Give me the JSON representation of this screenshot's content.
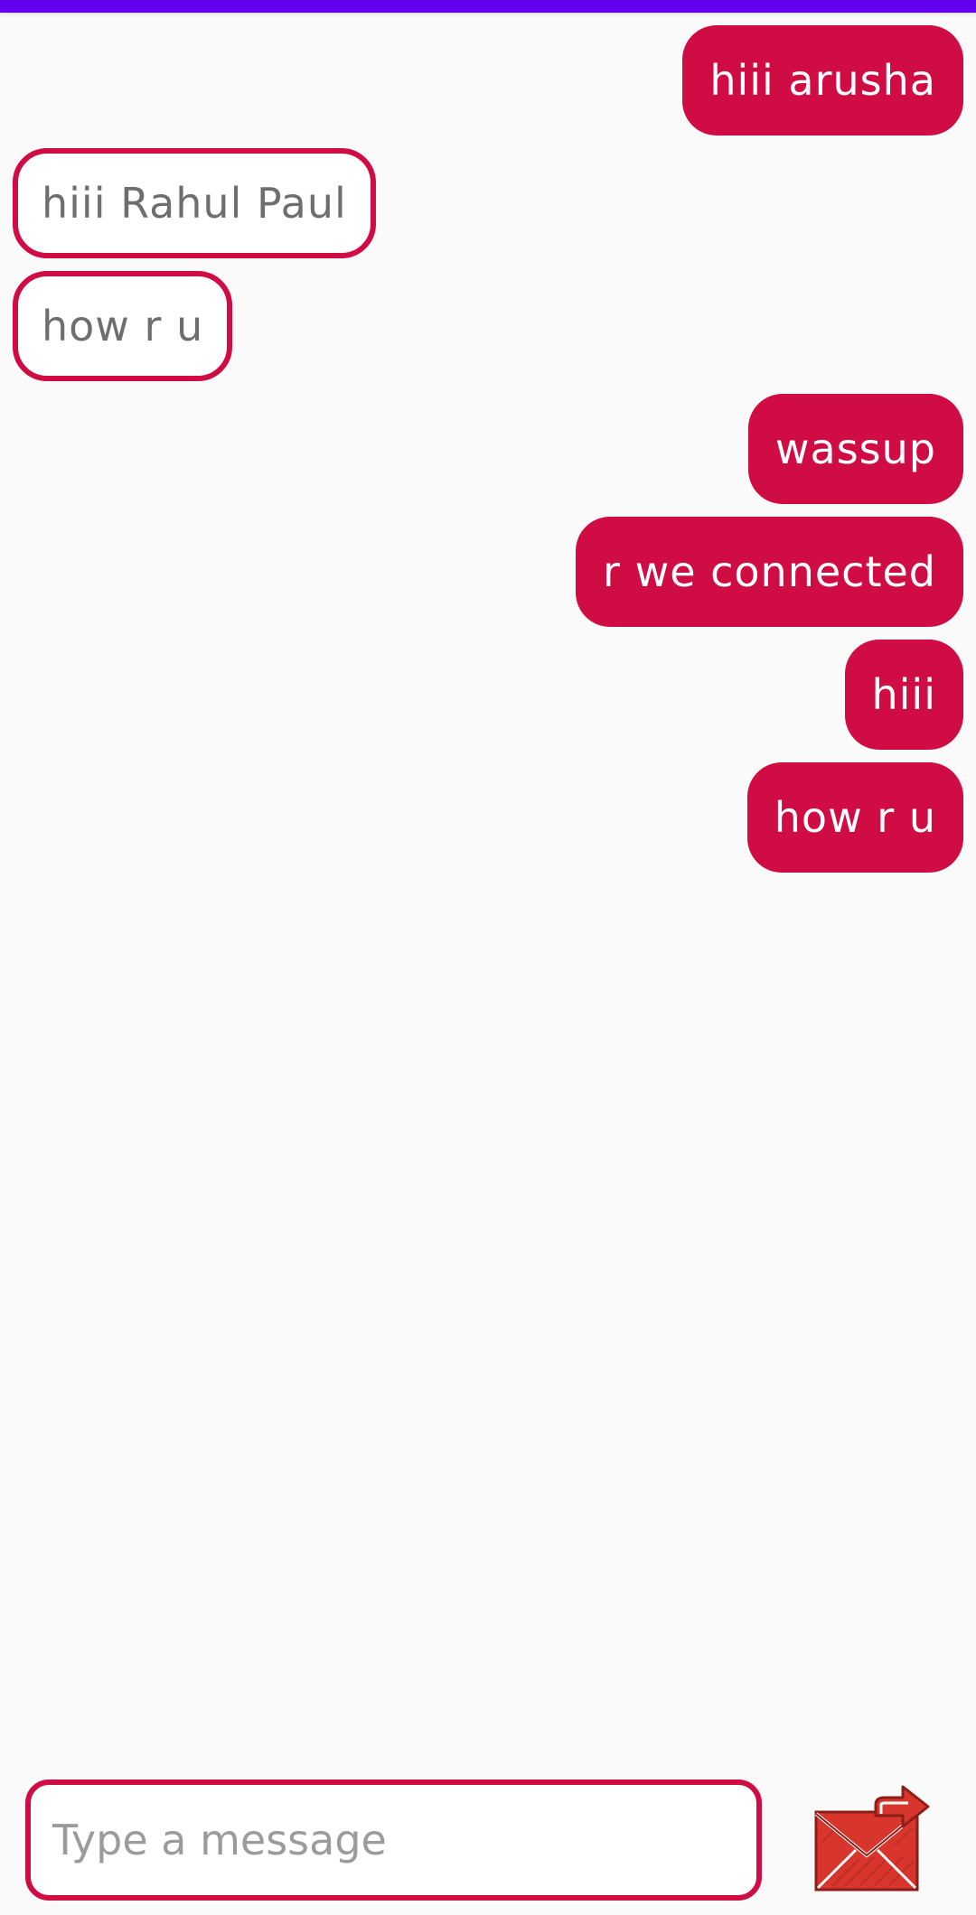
{
  "theme": {
    "status_bar_color": "#6200ee",
    "accent": "#d00c44",
    "received_text": "#6e6e6e",
    "background": "#fafafa"
  },
  "messages": [
    {
      "direction": "sent",
      "text": "hiii arusha"
    },
    {
      "direction": "received",
      "text": "hiii Rahul Paul"
    },
    {
      "direction": "received",
      "text": "how r u"
    },
    {
      "direction": "sent",
      "text": "wassup"
    },
    {
      "direction": "sent",
      "text": "r we connected"
    },
    {
      "direction": "sent",
      "text": "hiii"
    },
    {
      "direction": "sent",
      "text": "how r u"
    }
  ],
  "composer": {
    "placeholder": "Type a message",
    "value": ""
  },
  "send_button": {
    "icon": "envelope-send-icon"
  }
}
